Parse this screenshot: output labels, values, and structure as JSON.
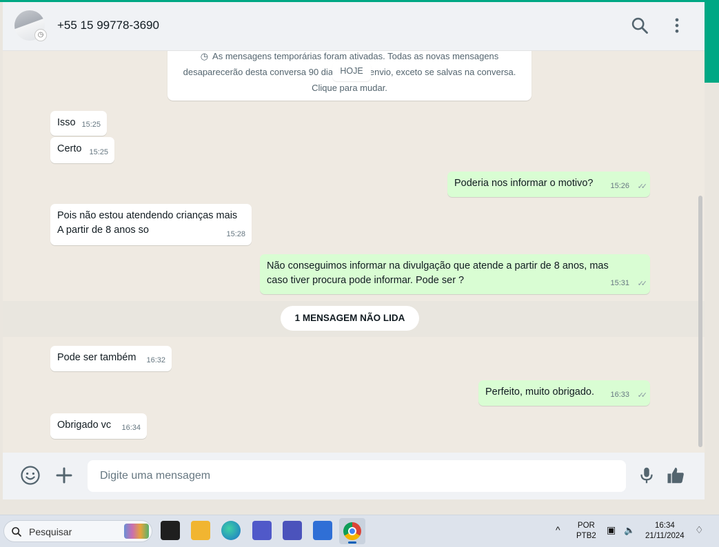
{
  "header": {
    "contact_name": "+55 15 99778-3690",
    "icons": [
      "search-icon",
      "menu-icon"
    ]
  },
  "system_message": {
    "line1": "As mensagens temporárias foram ativadas. Todas as novas mensagens",
    "line2": "desaparecerão desta conversa 90 dias após o envio, exceto se salvas na conversa.",
    "line3": "Clique para mudar."
  },
  "date_chip": "HOJE",
  "messages": [
    {
      "dir": "in",
      "text": "Isso",
      "time": "15:25"
    },
    {
      "dir": "in",
      "text": "Certo",
      "time": "15:25"
    },
    {
      "dir": "out",
      "text": "Poderia nos informar o motivo?",
      "time": "15:26"
    },
    {
      "dir": "in",
      "line1": "Pois não estou atendendo crianças mais",
      "line2": "A partir de 8 anos so",
      "time": "15:28"
    },
    {
      "dir": "out",
      "line1": "Não conseguimos informar na divulgação que atende a partir de 8 anos, mas",
      "line2": "caso tiver procura pode informar. Pode ser ?",
      "time": "15:31"
    },
    {
      "dir": "in",
      "text": "Pode ser também",
      "time": "16:32"
    },
    {
      "dir": "out",
      "text": "Perfeito, muito obrigado.",
      "time": "16:33"
    },
    {
      "dir": "in",
      "text": "Obrigado vc",
      "time": "16:34"
    }
  ],
  "unread_banner": "1 MENSAGEM NÃO LIDA",
  "composer": {
    "placeholder": "Digite uma mensagem",
    "icons": [
      "emoji-icon",
      "plus-icon",
      "microphone-icon",
      "thumbs-up-icon"
    ]
  },
  "taskbar": {
    "search_label": "Pesquisar",
    "lang_top": "POR",
    "lang_bottom": "PTB2",
    "clock_time": "16:34",
    "clock_date": "21/11/2024"
  },
  "colors": {
    "accent": "#00a884",
    "outgoing_bubble": "#d9fdd3",
    "incoming_bubble": "#ffffff",
    "chat_bg": "#efeae2"
  }
}
